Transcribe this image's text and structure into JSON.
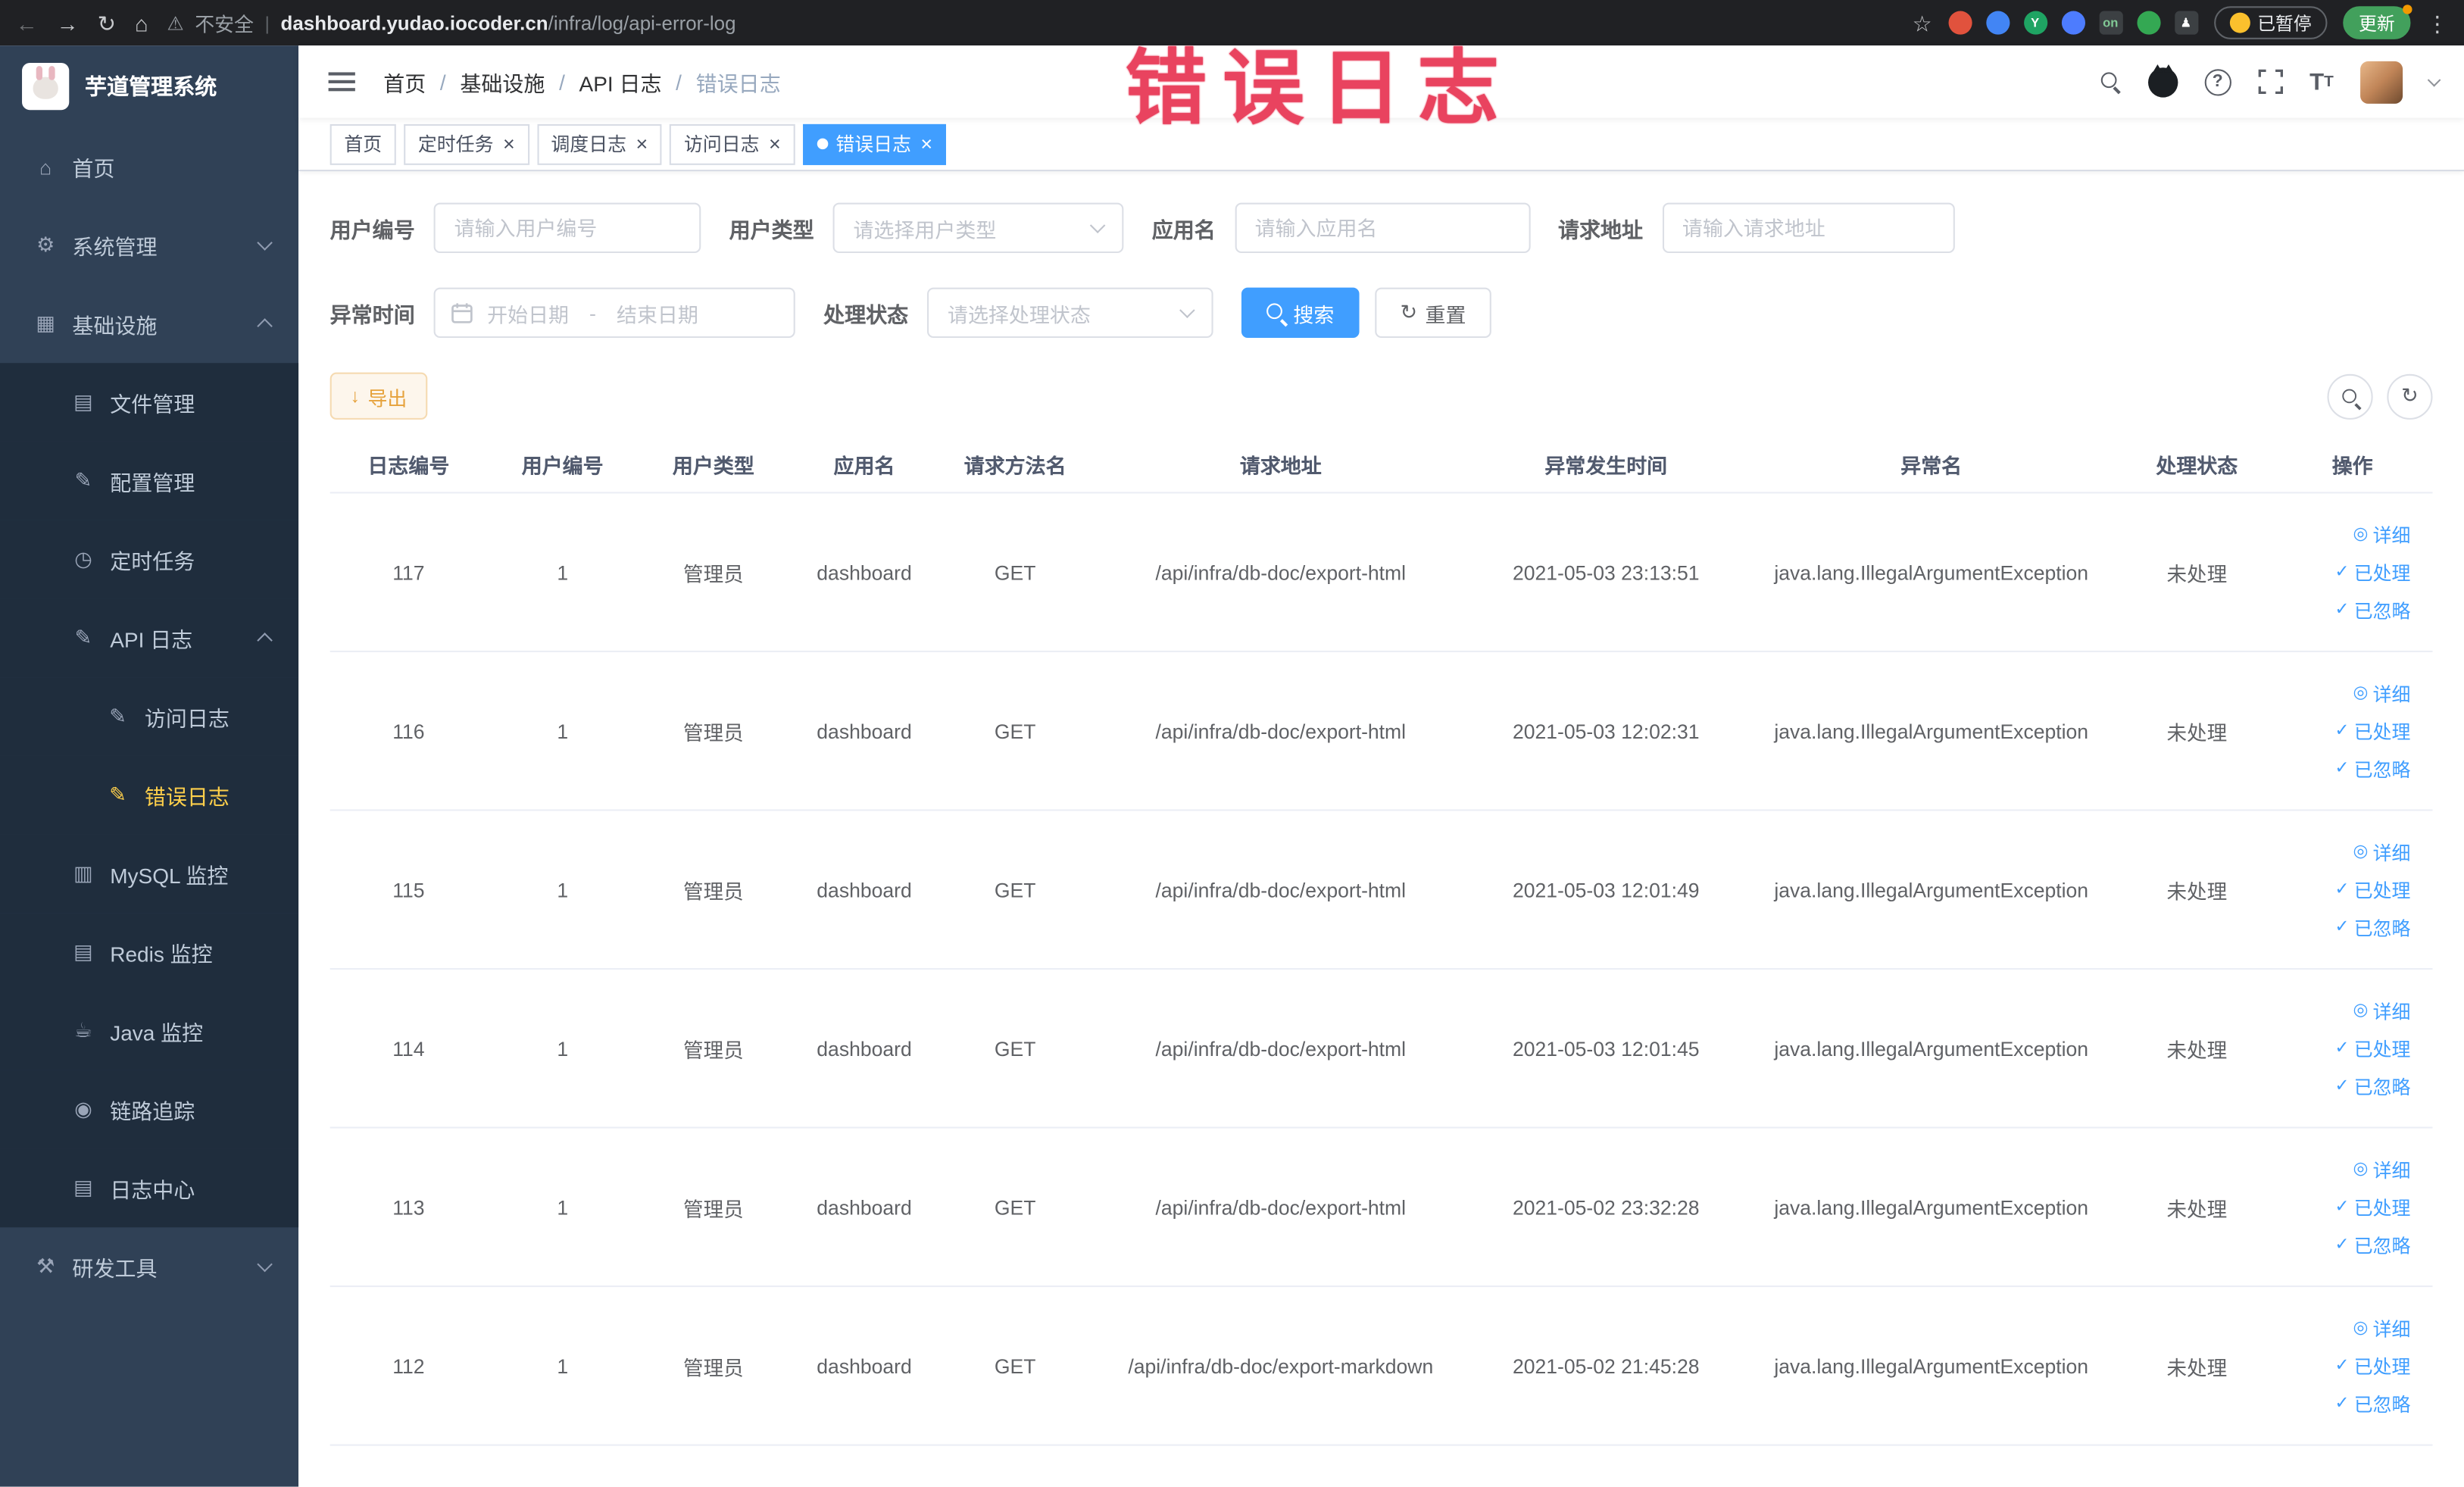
{
  "annotation": {
    "text": "错误日志"
  },
  "colors": {
    "accent": "#409eff",
    "menu_active": "#ffd04b",
    "sidebar_bg": "#304156",
    "sidebar_sub_bg": "#1f2d3d",
    "warning": "#e6a23c",
    "annotation": "#e9435f"
  },
  "browser": {
    "security_label": "不安全",
    "url_domain": "dashboard.yudao.iocoder.cn",
    "url_path": "/infra/log/api-error-log",
    "paused_label": "已暂停",
    "update_label": "更新",
    "extensions": [
      {
        "color": "#e1523d"
      },
      {
        "color": "#4285f4"
      },
      {
        "color": "#1fa463",
        "label": "Y"
      },
      {
        "color": "#4d7cfe"
      },
      {
        "color": "#3c4043",
        "label": "on",
        "label_color": "#81c995",
        "shape": "square"
      },
      {
        "color": "#34a853"
      },
      {
        "color": "#3c4043",
        "label": "♟",
        "shape": "square"
      }
    ]
  },
  "sidebar": {
    "logo_title": "芋道管理系统",
    "items": [
      {
        "key": "home",
        "label": "首页",
        "icon": "home-icon",
        "level": 0
      },
      {
        "key": "system",
        "label": "系统管理",
        "icon": "gear-icon",
        "level": 0,
        "arrow": "down"
      },
      {
        "key": "infra",
        "label": "基础设施",
        "icon": "grid-icon",
        "level": 0,
        "arrow": "up"
      },
      {
        "key": "file",
        "label": "文件管理",
        "icon": "folder-icon",
        "level": 1
      },
      {
        "key": "config",
        "label": "配置管理",
        "icon": "config-icon",
        "level": 1
      },
      {
        "key": "job",
        "label": "定时任务",
        "icon": "timer-icon",
        "level": 1
      },
      {
        "key": "api-log",
        "label": "API 日志",
        "icon": "api-log-icon",
        "level": 1,
        "arrow": "up"
      },
      {
        "key": "access-log",
        "label": "访问日志",
        "icon": "access-log-icon",
        "level": 2
      },
      {
        "key": "error-log",
        "label": "错误日志",
        "icon": "error-log-icon",
        "level": 2,
        "active": true
      },
      {
        "key": "mysql",
        "label": "MySQL 监控",
        "icon": "mysql-icon",
        "level": 1
      },
      {
        "key": "redis",
        "label": "Redis 监控",
        "icon": "redis-icon",
        "level": 1
      },
      {
        "key": "java",
        "label": "Java 监控",
        "icon": "java-icon",
        "level": 1
      },
      {
        "key": "trace",
        "label": "链路追踪",
        "icon": "trace-icon",
        "level": 1
      },
      {
        "key": "log-center",
        "label": "日志中心",
        "icon": "log-center-icon",
        "level": 1
      },
      {
        "key": "dev-tools",
        "label": "研发工具",
        "icon": "tools-icon",
        "level": 0,
        "arrow": "down"
      }
    ]
  },
  "header": {
    "breadcrumbs": [
      "首页",
      "基础设施",
      "API 日志",
      "错误日志"
    ]
  },
  "tabs": [
    {
      "key": "home",
      "label": "首页",
      "closable": false
    },
    {
      "key": "job",
      "label": "定时任务",
      "closable": true
    },
    {
      "key": "job-log",
      "label": "调度日志",
      "closable": true
    },
    {
      "key": "access-log",
      "label": "访问日志",
      "closable": true
    },
    {
      "key": "error-log",
      "label": "错误日志",
      "closable": true,
      "active": true
    }
  ],
  "filters": {
    "user_id_label": "用户编号",
    "user_id_placeholder": "请输入用户编号",
    "user_type_label": "用户类型",
    "user_type_placeholder": "请选择用户类型",
    "app_name_label": "应用名",
    "app_name_placeholder": "请输入应用名",
    "request_url_label": "请求地址",
    "request_url_placeholder": "请输入请求地址",
    "time_label": "异常时间",
    "start_placeholder": "开始日期",
    "range_separator": "-",
    "end_placeholder": "结束日期",
    "status_label": "处理状态",
    "status_placeholder": "请选择处理状态",
    "search_label": "搜索",
    "reset_label": "重置"
  },
  "toolbar": {
    "export_label": "导出"
  },
  "table": {
    "columns": [
      "日志编号",
      "用户编号",
      "用户类型",
      "应用名",
      "请求方法名",
      "请求地址",
      "异常发生时间",
      "异常名",
      "处理状态",
      "操作"
    ],
    "actions": {
      "detail": "详细",
      "processed": "已处理",
      "ignored": "已忽略"
    },
    "rows": [
      {
        "id": "117",
        "user_id": "1",
        "user_type": "管理员",
        "app": "dashboard",
        "method": "GET",
        "url": "/api/infra/db-doc/export-html",
        "time": "2021-05-03 23:13:51",
        "exception": "java.lang.IllegalArgumentException",
        "status": "未处理"
      },
      {
        "id": "116",
        "user_id": "1",
        "user_type": "管理员",
        "app": "dashboard",
        "method": "GET",
        "url": "/api/infra/db-doc/export-html",
        "time": "2021-05-03 12:02:31",
        "exception": "java.lang.IllegalArgumentException",
        "status": "未处理"
      },
      {
        "id": "115",
        "user_id": "1",
        "user_type": "管理员",
        "app": "dashboard",
        "method": "GET",
        "url": "/api/infra/db-doc/export-html",
        "time": "2021-05-03 12:01:49",
        "exception": "java.lang.IllegalArgumentException",
        "status": "未处理"
      },
      {
        "id": "114",
        "user_id": "1",
        "user_type": "管理员",
        "app": "dashboard",
        "method": "GET",
        "url": "/api/infra/db-doc/export-html",
        "time": "2021-05-03 12:01:45",
        "exception": "java.lang.IllegalArgumentException",
        "status": "未处理"
      },
      {
        "id": "113",
        "user_id": "1",
        "user_type": "管理员",
        "app": "dashboard",
        "method": "GET",
        "url": "/api/infra/db-doc/export-html",
        "time": "2021-05-02 23:32:28",
        "exception": "java.lang.IllegalArgumentException",
        "status": "未处理"
      },
      {
        "id": "112",
        "user_id": "1",
        "user_type": "管理员",
        "app": "dashboard",
        "method": "GET",
        "url": "/api/infra/db-doc/export-markdown",
        "time": "2021-05-02 21:45:28",
        "exception": "java.lang.IllegalArgumentException",
        "status": "未处理"
      }
    ]
  }
}
